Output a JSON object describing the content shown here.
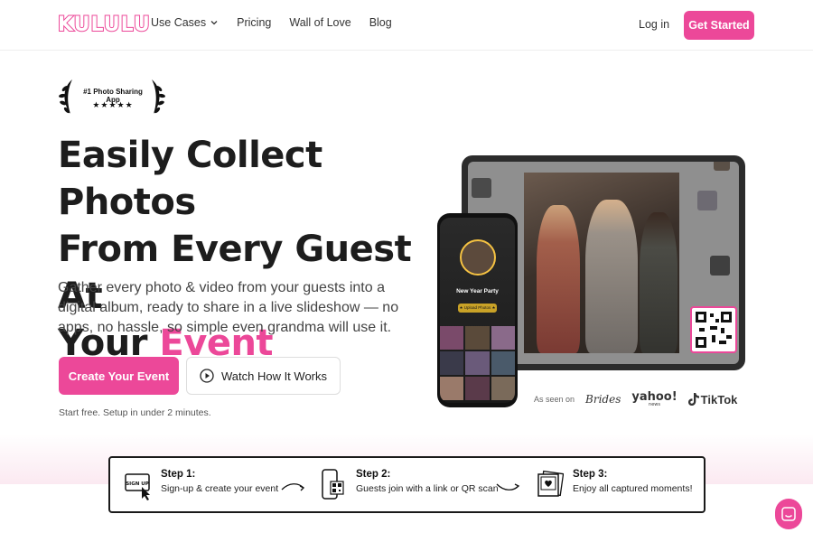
{
  "header": {
    "logo": "KULULU",
    "nav": [
      {
        "label": "Use Cases",
        "has_dropdown": true
      },
      {
        "label": "Pricing"
      },
      {
        "label": "Wall of Love"
      },
      {
        "label": "Blog"
      }
    ],
    "login_label": "Log in",
    "cta_label": "Get Started"
  },
  "award": {
    "text": "#1 Photo Sharing App",
    "stars": "★★★★★"
  },
  "hero": {
    "headline_lines": [
      "Easily Collect Photos",
      "From Every Guest At",
      "Your"
    ],
    "headline_accent": "Event",
    "subtext": "Gather every photo & video from your guests into a digital album, ready to share in a live slideshow — no apps, no hassle, so simple even grandma will use it.",
    "primary_cta": "Create Your Event",
    "secondary_cta": "Watch How It Works",
    "note": "Start free. Setup in under 2 minutes."
  },
  "phone": {
    "event_title": "New Year Party",
    "tag": "★ Upload Photos ★"
  },
  "as_seen_on": {
    "label": "As seen on",
    "brands": [
      "Brides",
      "yahoo!",
      "news",
      "TikTok"
    ]
  },
  "steps": [
    {
      "title": "Step 1:",
      "desc": "Sign-up & create your event",
      "icon_text": "SIGN UP"
    },
    {
      "title": "Step 2:",
      "desc": "Guests join with a link or QR scan"
    },
    {
      "title": "Step 3:",
      "desc": "Enjoy all captured moments!"
    }
  ],
  "colors": {
    "accent": "#ec4899",
    "text_dark": "#1d1d1d",
    "band_tint": "#fbe9f1"
  }
}
